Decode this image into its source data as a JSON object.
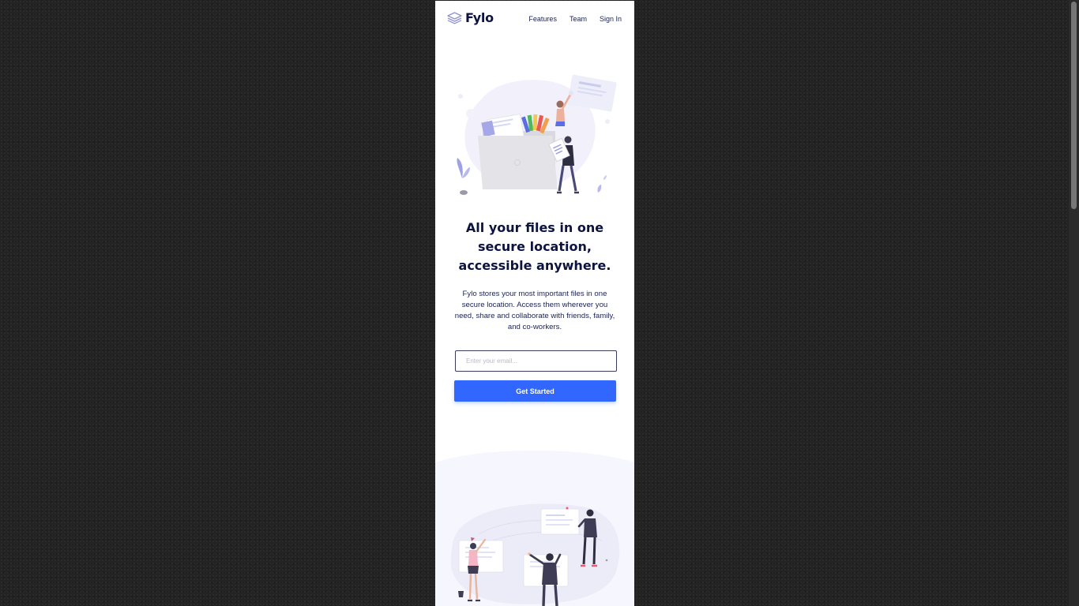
{
  "brand": {
    "name": "Fylo",
    "accent_color": "#3167ff",
    "text_color": "#0c1340"
  },
  "nav": {
    "links": [
      {
        "label": "Features"
      },
      {
        "label": "Team"
      },
      {
        "label": "Sign In"
      }
    ]
  },
  "hero": {
    "illustration_icon": "file-sharing-illustration",
    "headline": "All your files in one secure location, accessible anywhere.",
    "description": "Fylo stores your most important files in one secure location. Access them wherever you need, share and collaborate with friends, family, and co-workers.",
    "email_placeholder": "Enter your email...",
    "cta_label": "Get Started"
  },
  "features": {
    "illustration_icon": "team-collaboration-illustration"
  }
}
